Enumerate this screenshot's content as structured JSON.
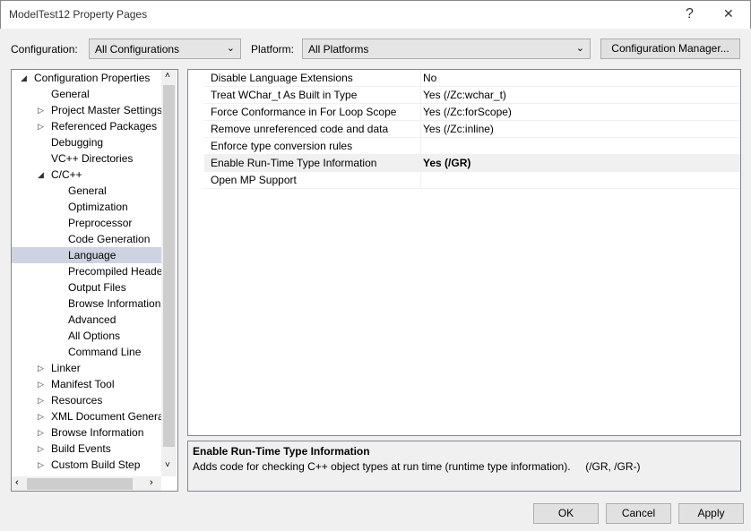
{
  "window": {
    "title": "ModelTest12 Property Pages",
    "help_label": "?",
    "close_label": "✕"
  },
  "toolbar": {
    "configuration_label": "Configuration:",
    "configuration_value": "All Configurations",
    "platform_label": "Platform:",
    "platform_value": "All Platforms",
    "config_manager_label": "Configuration Manager..."
  },
  "tree": {
    "items": [
      {
        "label": "Configuration Properties",
        "level": 0,
        "expander": "expanded"
      },
      {
        "label": "General",
        "level": 1,
        "expander": "none"
      },
      {
        "label": "Project Master Settings",
        "level": 1,
        "expander": "collapsed"
      },
      {
        "label": "Referenced Packages",
        "level": 1,
        "expander": "collapsed"
      },
      {
        "label": "Debugging",
        "level": 1,
        "expander": "none"
      },
      {
        "label": "VC++ Directories",
        "level": 1,
        "expander": "none"
      },
      {
        "label": "C/C++",
        "level": 1,
        "expander": "expanded"
      },
      {
        "label": "General",
        "level": 2,
        "expander": "none"
      },
      {
        "label": "Optimization",
        "level": 2,
        "expander": "none"
      },
      {
        "label": "Preprocessor",
        "level": 2,
        "expander": "none"
      },
      {
        "label": "Code Generation",
        "level": 2,
        "expander": "none"
      },
      {
        "label": "Language",
        "level": 2,
        "expander": "none",
        "selected": true
      },
      {
        "label": "Precompiled Headers",
        "level": 2,
        "expander": "none"
      },
      {
        "label": "Output Files",
        "level": 2,
        "expander": "none"
      },
      {
        "label": "Browse Information",
        "level": 2,
        "expander": "none"
      },
      {
        "label": "Advanced",
        "level": 2,
        "expander": "none"
      },
      {
        "label": "All Options",
        "level": 2,
        "expander": "none"
      },
      {
        "label": "Command Line",
        "level": 2,
        "expander": "none"
      },
      {
        "label": "Linker",
        "level": 1,
        "expander": "collapsed"
      },
      {
        "label": "Manifest Tool",
        "level": 1,
        "expander": "collapsed"
      },
      {
        "label": "Resources",
        "level": 1,
        "expander": "collapsed"
      },
      {
        "label": "XML Document Generator",
        "level": 1,
        "expander": "collapsed"
      },
      {
        "label": "Browse Information",
        "level": 1,
        "expander": "collapsed"
      },
      {
        "label": "Build Events",
        "level": 1,
        "expander": "collapsed"
      },
      {
        "label": "Custom Build Step",
        "level": 1,
        "expander": "collapsed"
      }
    ]
  },
  "grid": {
    "rows": [
      {
        "name": "Disable Language Extensions",
        "value": "No"
      },
      {
        "name": "Treat WChar_t As Built in Type",
        "value": "Yes (/Zc:wchar_t)"
      },
      {
        "name": "Force Conformance in For Loop Scope",
        "value": "Yes (/Zc:forScope)"
      },
      {
        "name": "Remove unreferenced code and data",
        "value": "Yes (/Zc:inline)"
      },
      {
        "name": "Enforce type conversion rules",
        "value": ""
      },
      {
        "name": "Enable Run-Time Type Information",
        "value": "Yes (/GR)",
        "selected": true,
        "bold": true
      },
      {
        "name": "Open MP Support",
        "value": ""
      }
    ]
  },
  "description": {
    "title": "Enable Run-Time Type Information",
    "text": "Adds code for checking C++ object types at run time (runtime type information).     (/GR, /GR-)"
  },
  "buttons": {
    "ok": "OK",
    "cancel": "Cancel",
    "apply": "Apply"
  }
}
